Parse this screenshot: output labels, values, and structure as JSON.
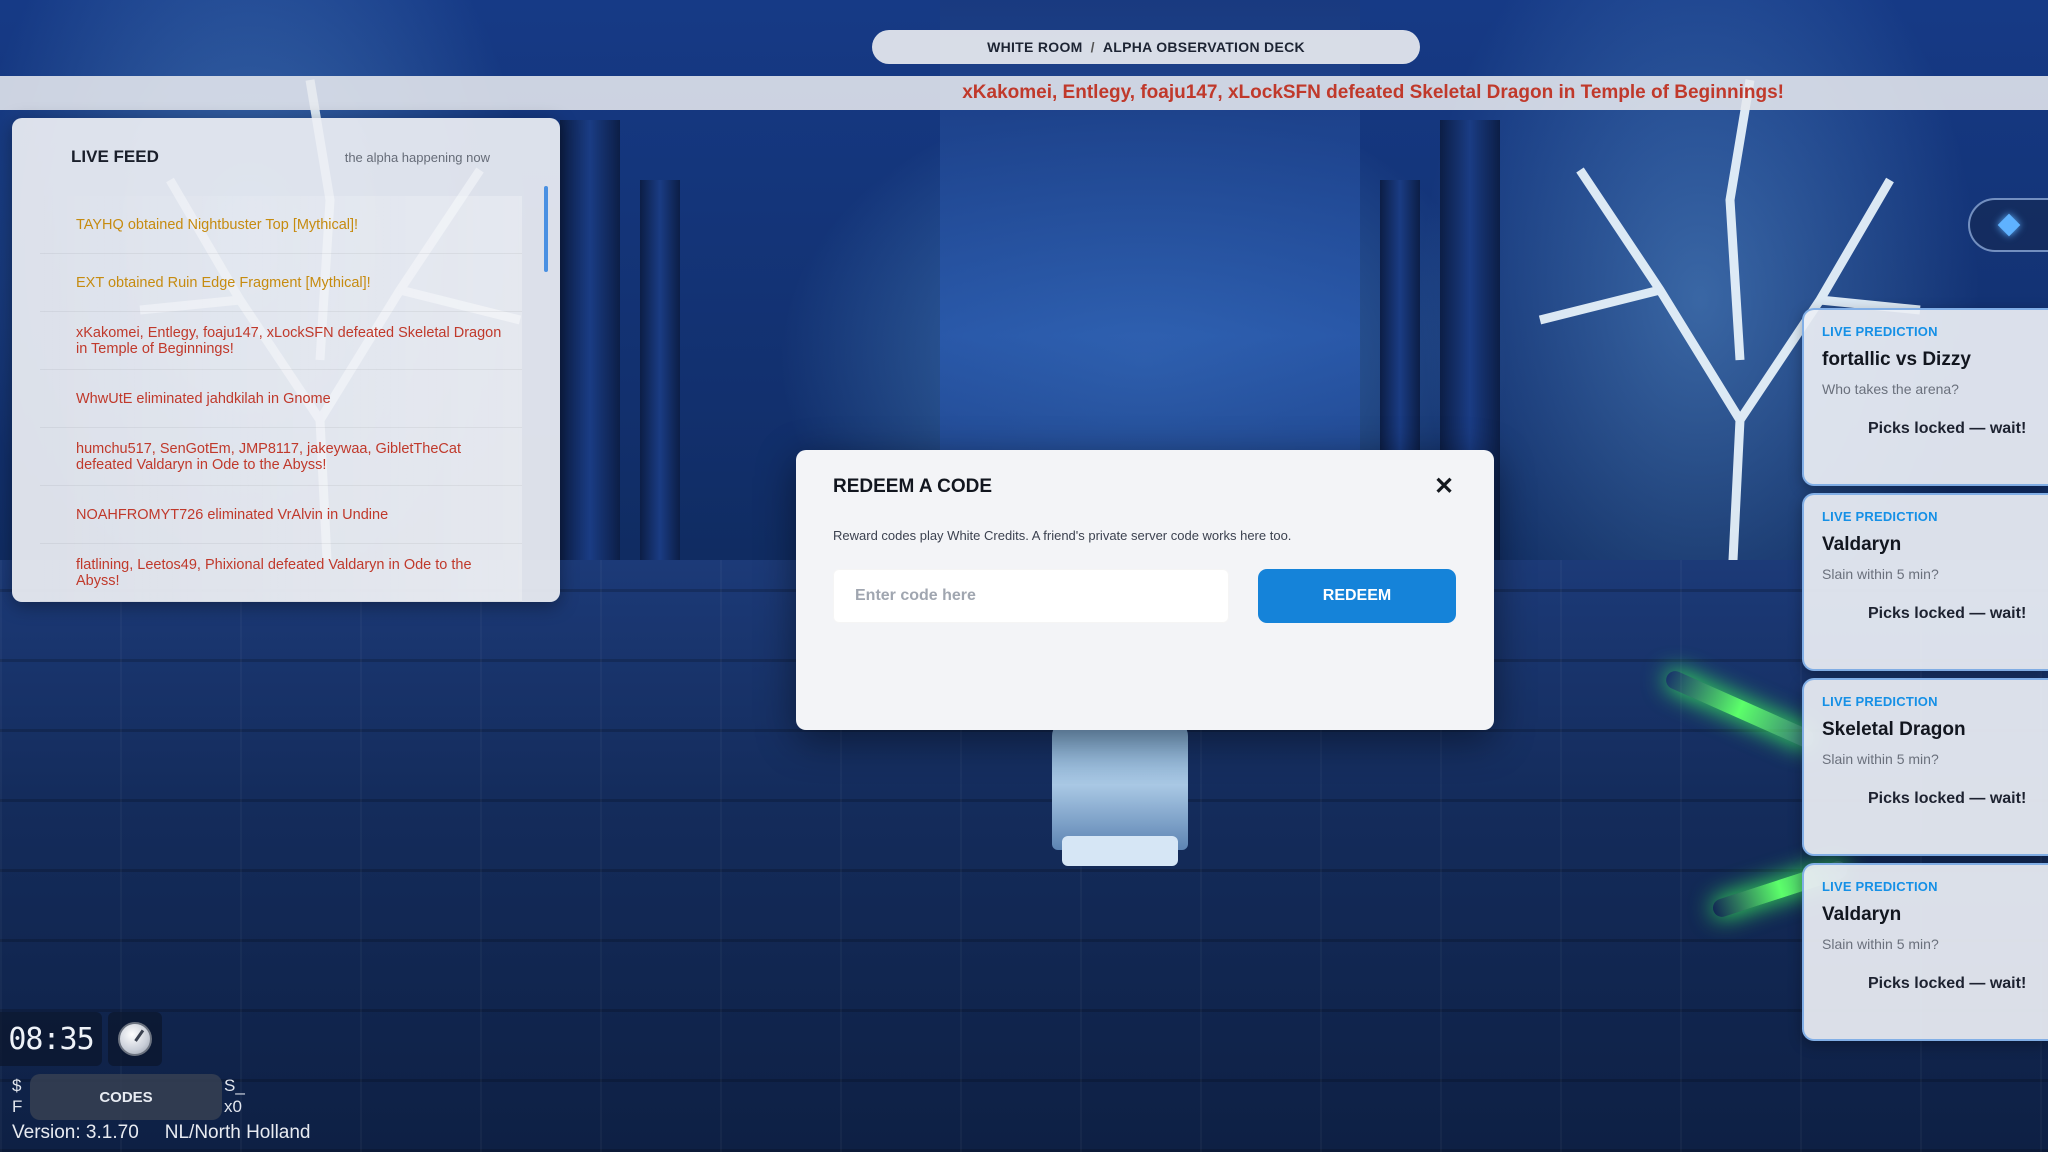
{
  "location": {
    "room": "WHITE ROOM",
    "separator": "/",
    "area": "ALPHA OBSERVATION DECK"
  },
  "ticker": {
    "message": "xKakomei, Entlegy, foaju147, xLockSFN defeated Skeletal Dragon in Temple of Beginnings!"
  },
  "live_feed": {
    "title": "LIVE FEED",
    "subtitle": "the alpha happening now",
    "items": [
      {
        "text": "TAYHQ obtained Nightbuster Top [Mythical]!",
        "kind": "mythic"
      },
      {
        "text": "EXT obtained Ruin Edge Fragment [Mythical]!",
        "kind": "mythic"
      },
      {
        "text": "xKakomei, Entlegy, foaju147, xLockSFN defeated Skeletal Dragon in Temple of Beginnings!",
        "kind": "defeat"
      },
      {
        "text": "WhwUtE eliminated jahdkilah in Gnome",
        "kind": "defeat"
      },
      {
        "text": "humchu517, SenGotEm, JMP8117, jakeywaa, GibletTheCat defeated Valdaryn in Ode to the Abyss!",
        "kind": "defeat"
      },
      {
        "text": "NOAHFROMYT726 eliminated VrAlvin in Undine",
        "kind": "defeat"
      },
      {
        "text": "flatlining, Leetos49, Phixional defeated Valdaryn in Ode to the Abyss!",
        "kind": "defeat"
      }
    ]
  },
  "modal": {
    "title": "REDEEM A CODE",
    "close_symbol": "✕",
    "description": "Reward codes play White Credits. A friend's private server code works here too.",
    "input_placeholder": "Enter code here",
    "input_value": "",
    "redeem_label": "REDEEM"
  },
  "predictions": [
    {
      "label": "LIVE PREDICTION",
      "title": "fortallic vs Dizzy",
      "question": "Who takes the arena?",
      "status": "Picks locked — wait!"
    },
    {
      "label": "LIVE PREDICTION",
      "title": "Valdaryn",
      "question": "Slain within 5 min?",
      "status": "Picks locked — wait!"
    },
    {
      "label": "LIVE PREDICTION",
      "title": "Skeletal Dragon",
      "question": "Slain within 5 min?",
      "status": "Picks locked — wait!"
    },
    {
      "label": "LIVE PREDICTION",
      "title": "Valdaryn",
      "question": "Slain within 5 min?",
      "status": "Picks locked — wait!"
    }
  ],
  "hud": {
    "clock": "08:35",
    "codes_label": "CODES",
    "frag_left_top": "$",
    "frag_left_bottom": "F",
    "frag_right_top": "S_",
    "frag_right_bottom": "x0",
    "version": "Version: 3.1.70",
    "region": "NL/North Holland"
  },
  "colors": {
    "accent_blue": "#1583d9",
    "prediction_label": "#1590e6",
    "feed_defeat": "#c0392b",
    "feed_mythic": "#c68b10"
  },
  "icons": {
    "close": "close-icon",
    "side_toggle": "diamond-icon",
    "compass": "compass-icon"
  }
}
